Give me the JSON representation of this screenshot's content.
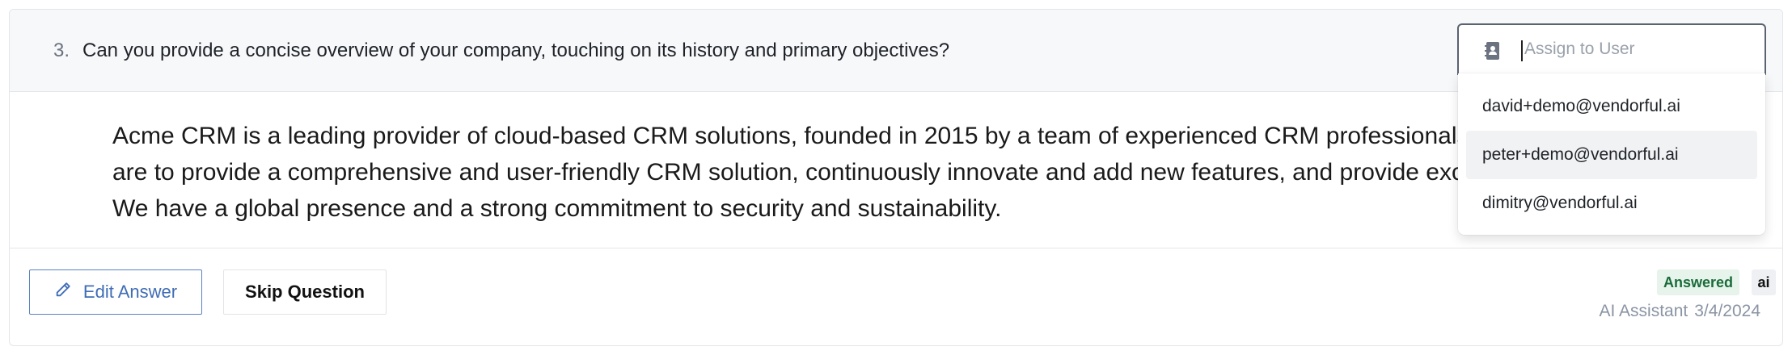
{
  "question": {
    "number": "3.",
    "text": "Can you provide a concise overview of your company, touching on its history and primary objectives?"
  },
  "answer": {
    "lines": [
      "Acme CRM is a leading provider of cloud-based CRM solutions, founded in 2015 by a team of experienced CRM professionals. Our",
      "are to provide a comprehensive and user-friendly CRM solution, continuously innovate and add new features, and provide exception",
      "We have a global presence and a strong commitment to security and sustainability."
    ]
  },
  "actions": {
    "edit_label": "Edit Answer",
    "skip_label": "Skip Question"
  },
  "status": {
    "badge": "Answered",
    "source_tag": "ai",
    "author": "AI Assistant",
    "date": "3/4/2024",
    "badge_bg": "#e6f4ec",
    "badge_color": "#1b6b3a"
  },
  "assign": {
    "placeholder": "Assign to User",
    "icon": "contact-book-icon",
    "options": [
      "david+demo@vendorful.ai",
      "peter+demo@vendorful.ai",
      "dimitry@vendorful.ai"
    ],
    "highlighted_option": "peter+demo@vendorful.ai"
  },
  "colors": {
    "accent": "#3f6db5",
    "header_bg": "#f7f8fa"
  }
}
